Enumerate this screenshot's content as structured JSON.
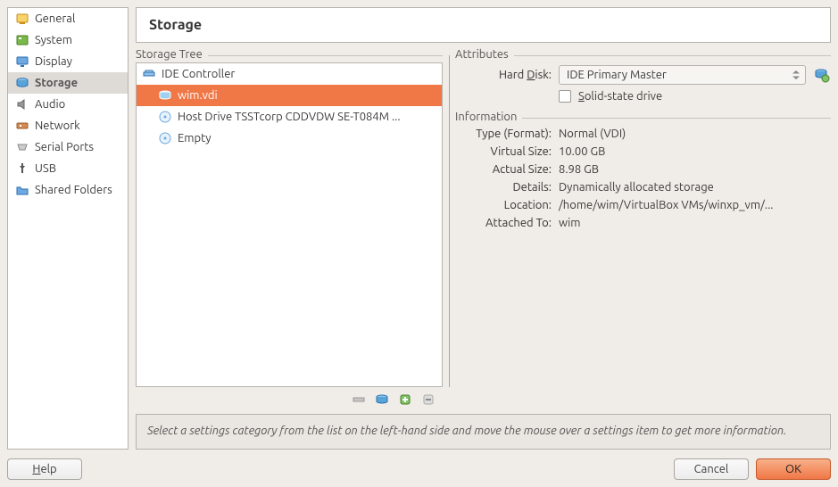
{
  "sidebar": {
    "items": [
      {
        "label": "General"
      },
      {
        "label": "System"
      },
      {
        "label": "Display"
      },
      {
        "label": "Storage"
      },
      {
        "label": "Audio"
      },
      {
        "label": "Network"
      },
      {
        "label": "Serial Ports"
      },
      {
        "label": "USB"
      },
      {
        "label": "Shared Folders"
      }
    ],
    "selected_index": 3
  },
  "page_title": "Storage",
  "storage_tree": {
    "label": "Storage Tree",
    "controller": "IDE Controller",
    "items": [
      {
        "label": "wim.vdi"
      },
      {
        "label": "Host Drive TSSTcorp CDDVDW SE-T084M ..."
      },
      {
        "label": "Empty"
      }
    ],
    "selected_item_index": 0
  },
  "attributes": {
    "label": "Attributes",
    "hard_disk_label_pre": "Hard ",
    "hard_disk_label_u": "D",
    "hard_disk_label_post": "isk:",
    "hard_disk_value": "IDE Primary Master",
    "ssd_pre": "",
    "ssd_u": "S",
    "ssd_post": "olid-state drive"
  },
  "information": {
    "label": "Information",
    "rows": [
      {
        "k": "Type (Format):",
        "v": "Normal (VDI)"
      },
      {
        "k": "Virtual Size:",
        "v": "10.00 GB"
      },
      {
        "k": "Actual Size:",
        "v": "8.98 GB"
      },
      {
        "k": "Details:",
        "v": "Dynamically allocated storage"
      },
      {
        "k": "Location:",
        "v": "/home/wim/VirtualBox VMs/winxp_vm/..."
      },
      {
        "k": "Attached To:",
        "v": "wim"
      }
    ]
  },
  "hint": "Select a settings category from the list on the left-hand side and move the mouse over a settings item to get more information.",
  "buttons": {
    "help_u": "H",
    "help_post": "elp",
    "cancel": "Cancel",
    "ok": "OK"
  }
}
